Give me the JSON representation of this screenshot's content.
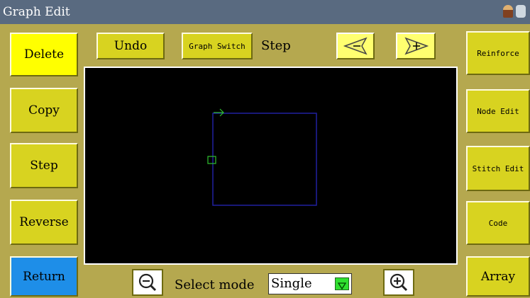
{
  "window": {
    "title": "Graph Edit",
    "icons": [
      "user-icon",
      "database-icon"
    ]
  },
  "left_buttons": {
    "delete": "Delete",
    "copy": "Copy",
    "step": "Step",
    "reverse": "Reverse",
    "return": "Return"
  },
  "top_bar": {
    "undo": "Undo",
    "graph_switch": "Graph Switch",
    "step_label": "Step",
    "prev_icon": "left-arrow-icon",
    "next_icon": "right-arrow-icon"
  },
  "right_buttons": {
    "reinforce": "Reinforce",
    "node_edit": "Node Edit",
    "stitch_edit": "Stitch Edit",
    "code": "Code",
    "array": "Array"
  },
  "bottom_bar": {
    "zoom_out_icon": "zoom-out-icon",
    "select_mode_label": "Select mode",
    "select_mode_value": "Single",
    "zoom_in_icon": "zoom-in-icon"
  },
  "canvas": {
    "shape": "rectangle-pattern",
    "stroke_color": "#2020a0",
    "marker_color": "#30c030"
  },
  "colors": {
    "background": "#b5a84f",
    "button": "#d8d320",
    "button_highlight": "#ffff00",
    "return_button": "#1e8ee8",
    "titlebar": "#596a80"
  }
}
